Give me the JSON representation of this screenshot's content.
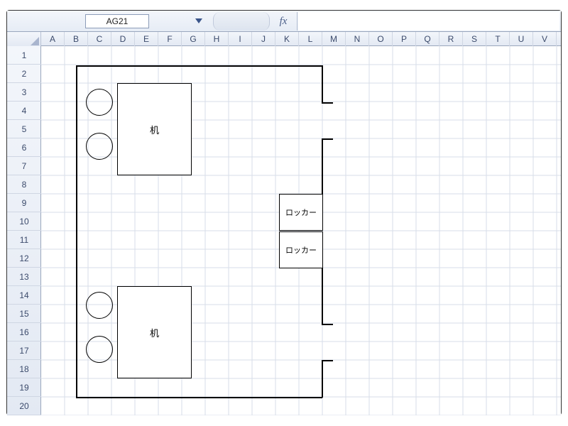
{
  "namebox": {
    "value": "AG21"
  },
  "fx": {
    "label": "fx",
    "value": ""
  },
  "columns": [
    "A",
    "B",
    "C",
    "D",
    "E",
    "F",
    "G",
    "H",
    "I",
    "J",
    "K",
    "L",
    "M",
    "N",
    "O",
    "P",
    "Q",
    "R",
    "S",
    "T",
    "U",
    "V"
  ],
  "rows": [
    "1",
    "2",
    "3",
    "4",
    "5",
    "6",
    "7",
    "8",
    "9",
    "10",
    "11",
    "12",
    "13",
    "14",
    "15",
    "16",
    "17",
    "18",
    "19",
    "20"
  ],
  "shapes": {
    "desk1_label": "机",
    "desk2_label": "机",
    "locker1_label": "ロッカー",
    "locker2_label": "ロッカー"
  }
}
